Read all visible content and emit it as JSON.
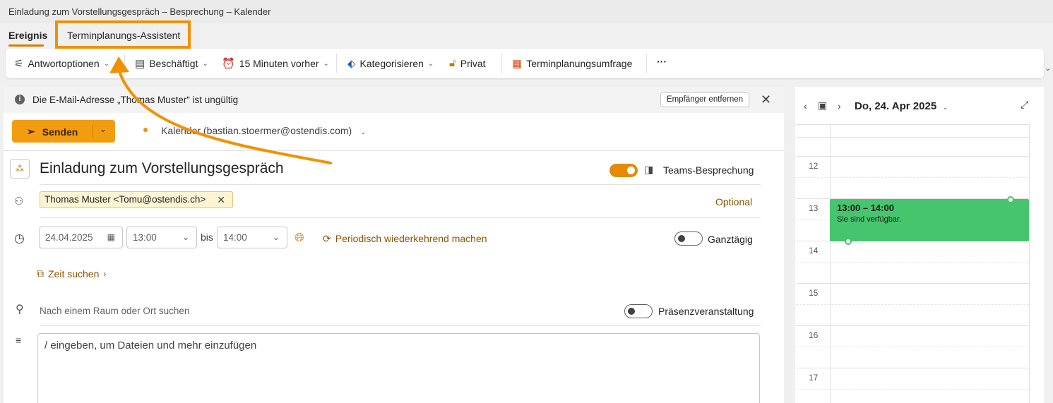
{
  "window": {
    "title": "Einladung zum Vorstellungsgespräch – Besprechung – Kalender"
  },
  "tabs": [
    {
      "label": "Ereignis",
      "active": true
    },
    {
      "label": "Terminplanungs-Assistent",
      "active": false,
      "highlighted": true
    }
  ],
  "toolbar": {
    "response_options": "Antwortoptionen",
    "busy": "Beschäftigt",
    "reminder": "15 Minuten vorher",
    "categorize": "Kategorisieren",
    "private": "Privat",
    "scheduling_poll": "Terminplanungsumfrage",
    "more": "···"
  },
  "info_bar": {
    "message": "Die E-Mail-Adresse „Thomas Muster“ ist ungültig",
    "remove_button": "Empfänger entfernen"
  },
  "compose": {
    "send_label": "Senden",
    "calendar": "Kalender (bastian.stoermer@ostendis.com)",
    "subject": "Einladung zum Vorstellungsgespräch",
    "teams_label": "Teams-Besprechung",
    "teams_enabled": true,
    "recipient": "Thomas Muster <Tomu@ostendis.ch>",
    "optional_label": "Optional",
    "start_date": "24.04.2025",
    "start_time": "13:00",
    "bis_label": "bis",
    "end_time": "14:00",
    "recurring_label": "Periodisch wiederkehrend machen",
    "all_day_label": "Ganztägig",
    "all_day": false,
    "find_time": "Zeit suchen",
    "location_placeholder": "Nach einem Raum oder Ort suchen",
    "in_person_label": "Präsenzveranstaltung",
    "in_person": false,
    "body_placeholder": "/ eingeben, um Dateien und mehr einzufügen"
  },
  "calendar_panel": {
    "date": "Do, 24. Apr 2025",
    "hours": [
      "12",
      "13",
      "14",
      "15",
      "16",
      "17"
    ],
    "event": {
      "time": "13:00 – 14:00",
      "status": "Sie sind verfügbar."
    }
  },
  "colors": {
    "accent": "#f29d0f",
    "event": "#46c46e",
    "highlight": "#f29100"
  }
}
